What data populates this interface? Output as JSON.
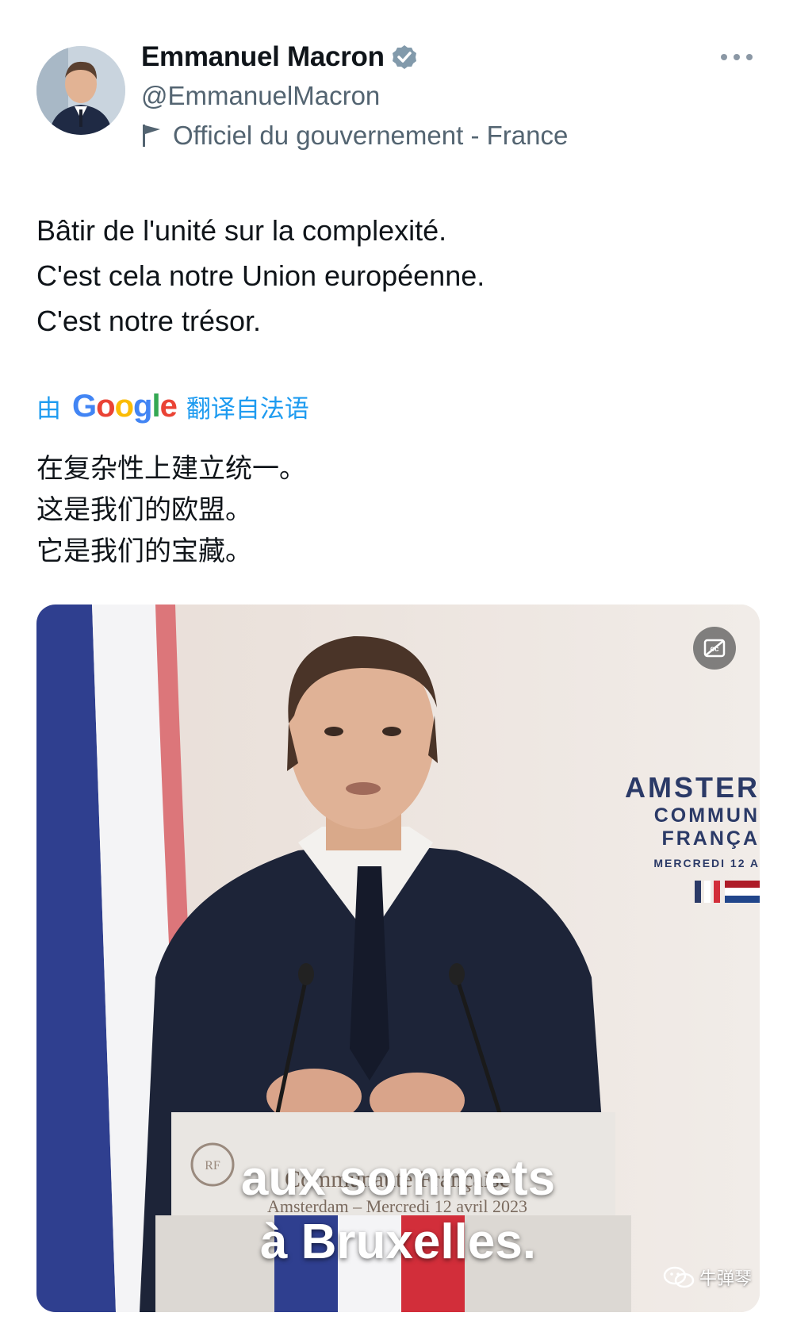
{
  "author": {
    "name": "Emmanuel Macron",
    "handle": "@EmmanuelMacron",
    "affiliation": "Officiel du gouvernement - France"
  },
  "tweet": {
    "lines": [
      "Bâtir de l'unité sur la complexité.",
      "C'est cela notre Union européenne.",
      "C'est notre trésor."
    ]
  },
  "translation": {
    "prefix": "由",
    "provider": "Google",
    "suffix": "翻译自法语",
    "lines": [
      "在复杂性上建立统一。",
      "这是我们的欧盟。",
      "它是我们的宝藏。"
    ]
  },
  "video": {
    "subtitle_lines": [
      "aux sommets",
      "à Bruxelles."
    ],
    "event_sign": {
      "title": "AMSTER",
      "line1": "COMMUN",
      "line2": "FRANÇA",
      "date": "MERCREDI 12 A"
    },
    "podium": {
      "line1": "Communauté Française",
      "line2": "Amsterdam – Mercredi 12 avril 2023"
    },
    "watermark": "牛弹琴"
  },
  "colors": {
    "accent": "#1d9bf0",
    "text_primary": "#0f1419",
    "text_secondary": "#536471"
  },
  "icons": {
    "verified": "verified-badge-icon",
    "affiliation": "flag-icon",
    "more": "more-options-icon",
    "captions": "closed-captions-icon",
    "watermark": "wechat-icon"
  }
}
